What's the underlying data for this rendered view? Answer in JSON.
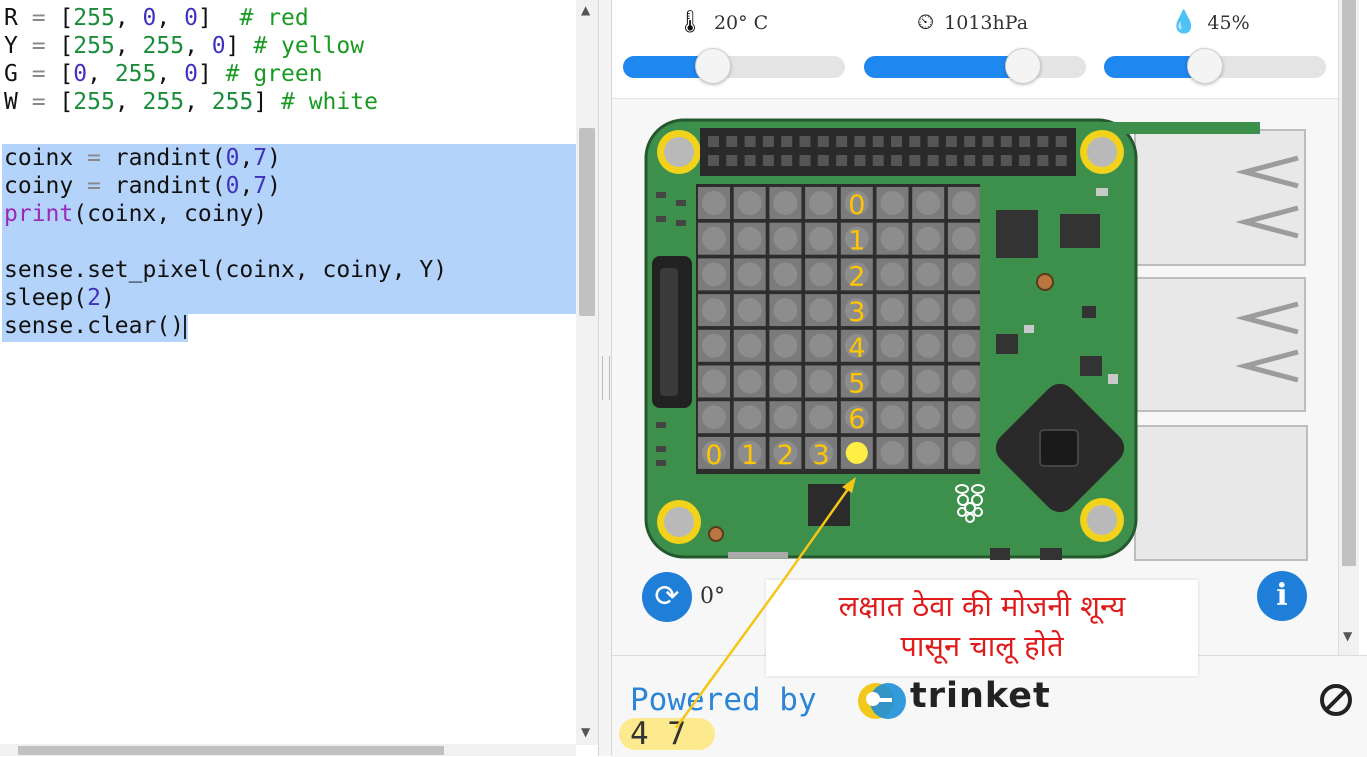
{
  "editor": {
    "lines": [
      [
        [
          "var",
          "R"
        ],
        [
          "op",
          " = "
        ],
        [
          "var",
          "["
        ],
        [
          "num",
          "255"
        ],
        [
          "var",
          ", "
        ],
        [
          "num2",
          "0"
        ],
        [
          "var",
          ", "
        ],
        [
          "num2",
          "0"
        ],
        [
          "var",
          "]"
        ],
        [
          "var",
          "  "
        ],
        [
          "com",
          "# red"
        ]
      ],
      [
        [
          "var",
          "Y"
        ],
        [
          "op",
          " = "
        ],
        [
          "var",
          "["
        ],
        [
          "num",
          "255"
        ],
        [
          "var",
          ", "
        ],
        [
          "num",
          "255"
        ],
        [
          "var",
          ", "
        ],
        [
          "num2",
          "0"
        ],
        [
          "var",
          "] "
        ],
        [
          "com",
          "# yellow"
        ]
      ],
      [
        [
          "var",
          "G"
        ],
        [
          "op",
          " = "
        ],
        [
          "var",
          "["
        ],
        [
          "num2",
          "0"
        ],
        [
          "var",
          ", "
        ],
        [
          "num",
          "255"
        ],
        [
          "var",
          ", "
        ],
        [
          "num2",
          "0"
        ],
        [
          "var",
          "] "
        ],
        [
          "com",
          "# green"
        ]
      ],
      [
        [
          "var",
          "W"
        ],
        [
          "op",
          " = "
        ],
        [
          "var",
          "["
        ],
        [
          "num",
          "255"
        ],
        [
          "var",
          ", "
        ],
        [
          "num",
          "255"
        ],
        [
          "var",
          ", "
        ],
        [
          "num",
          "255"
        ],
        [
          "var",
          "] "
        ],
        [
          "com",
          "# white"
        ]
      ],
      [],
      [
        [
          "var",
          "coinx"
        ],
        [
          "op",
          " = "
        ],
        [
          "var",
          "randint("
        ],
        [
          "num2",
          "0"
        ],
        [
          "var",
          ","
        ],
        [
          "num2",
          "7"
        ],
        [
          "var",
          ")"
        ]
      ],
      [
        [
          "var",
          "coiny"
        ],
        [
          "op",
          " = "
        ],
        [
          "var",
          "randint("
        ],
        [
          "num2",
          "0"
        ],
        [
          "var",
          ","
        ],
        [
          "num2",
          "7"
        ],
        [
          "var",
          ")"
        ]
      ],
      [
        [
          "kw",
          "print"
        ],
        [
          "var",
          "(coinx, coiny)"
        ]
      ],
      [],
      [
        [
          "var",
          "sense.set_pixel(coinx, coiny, Y)"
        ]
      ],
      [
        [
          "var",
          "sleep("
        ],
        [
          "num2",
          "2"
        ],
        [
          "var",
          ")"
        ]
      ],
      [
        [
          "var",
          "sense.clear()"
        ]
      ]
    ]
  },
  "sensors": {
    "temperature": {
      "label": "20° C",
      "icon": "thermometer-icon",
      "level": 0.4
    },
    "pressure": {
      "label": "1013hPa",
      "icon": "gauge-icon",
      "level": 0.71
    },
    "humidity": {
      "label": "45%",
      "icon": "water-drop-icon",
      "level": 0.45
    }
  },
  "board": {
    "column_labels": [
      "0",
      "1",
      "2",
      "3"
    ],
    "row_labels": [
      "0",
      "1",
      "2",
      "3",
      "4",
      "5",
      "6"
    ],
    "lit_pixel": {
      "x": 4,
      "y": 7,
      "color": "#ffee44"
    },
    "label_color": "#ffc500"
  },
  "controls": {
    "rotation": "0°",
    "rotate_icon": "rotate-icon",
    "info_label": "i"
  },
  "console": {
    "powered_by": "Powered by",
    "brand": "trinket",
    "output": "4 7",
    "stop_icon": "stop-icon"
  },
  "annotation": {
    "line1": "लक्षात ठेवा की मोजनी शून्य",
    "line2": "पासून चालू होते"
  },
  "colors": {
    "accent": "#1e87f0",
    "selection": "#b4d3fb",
    "pcb_green": "#3d8f4c",
    "callout_text": "#e01b1b",
    "arrow": "#f5c518"
  }
}
